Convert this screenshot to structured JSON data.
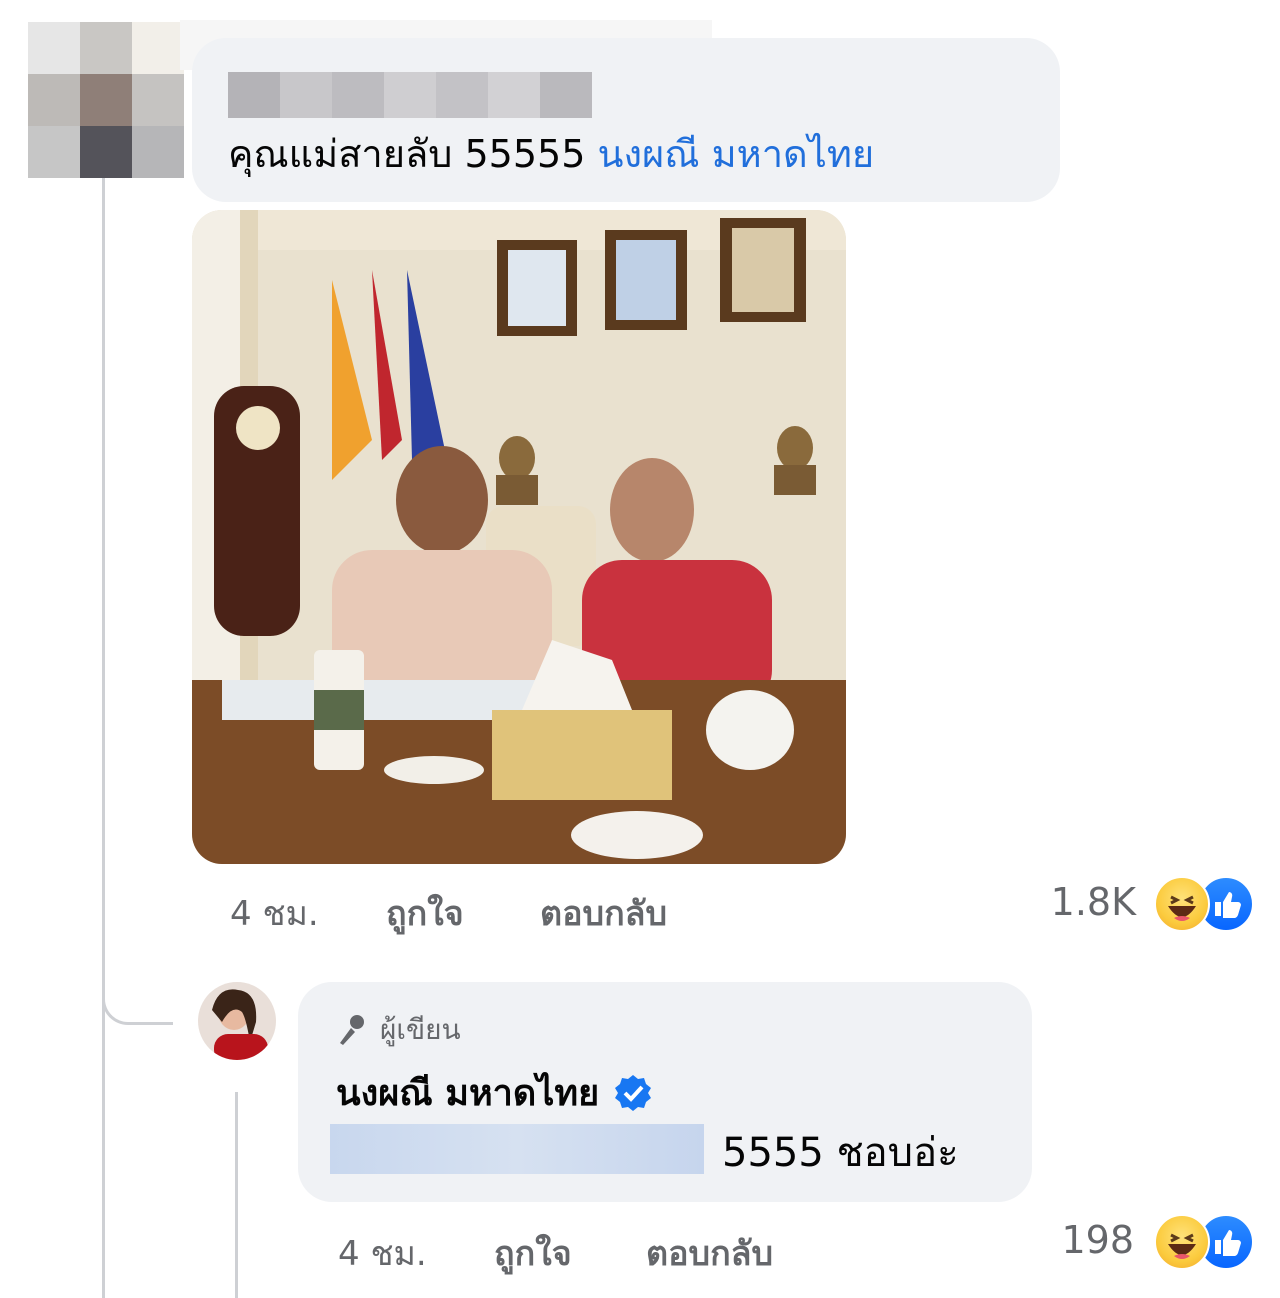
{
  "comment": {
    "text": "คุณแม่สายลับ 55555",
    "mention": "นงผณี มหาดไทย",
    "time": "4 ชม.",
    "like_label": "ถูกใจ",
    "reply_label": "ตอบกลับ",
    "reaction_count": "1.8K"
  },
  "reply": {
    "badge": "ผู้เขียน",
    "author": "นงผณี มหาดไทย",
    "text": "5555 ชอบอ่ะ",
    "time": "4 ชม.",
    "like_label": "ถูกใจ",
    "reply_label": "ตอบกลับ",
    "reaction_count": "198"
  },
  "colors": {
    "bubble": "#f0f2f5",
    "link": "#216fdb",
    "muted": "#65676b",
    "like_blue": "#0866ff"
  },
  "icons": [
    "haha-reaction-icon",
    "like-reaction-icon",
    "author-microphone-icon",
    "verified-badge-icon"
  ]
}
